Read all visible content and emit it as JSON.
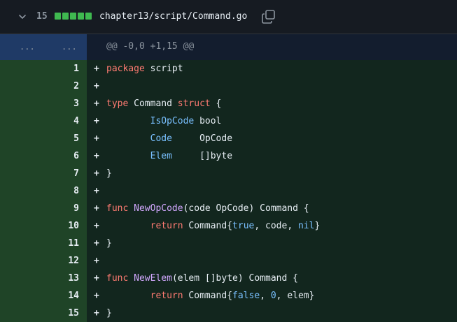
{
  "file": {
    "change_count": "15",
    "diffstat_blocks": 5,
    "path": "chapter13/script/Command.go",
    "accent_add": "#3fb950"
  },
  "hunk": {
    "old_dots": "...",
    "new_dots": "...",
    "header": "@@ -0,0 +1,15 @@"
  },
  "lines": [
    {
      "num": "1",
      "marker": "+",
      "tokens": [
        {
          "t": "package",
          "c": "kw"
        },
        {
          "t": " script",
          "c": ""
        }
      ]
    },
    {
      "num": "2",
      "marker": "+",
      "tokens": []
    },
    {
      "num": "3",
      "marker": "+",
      "tokens": [
        {
          "t": "type",
          "c": "kw"
        },
        {
          "t": " Command ",
          "c": ""
        },
        {
          "t": "struct",
          "c": "kw"
        },
        {
          "t": " {",
          "c": ""
        }
      ]
    },
    {
      "num": "4",
      "marker": "+",
      "tokens": [
        {
          "t": "        ",
          "c": ""
        },
        {
          "t": "IsOpCode",
          "c": "fld"
        },
        {
          "t": " bool",
          "c": ""
        }
      ]
    },
    {
      "num": "5",
      "marker": "+",
      "tokens": [
        {
          "t": "        ",
          "c": ""
        },
        {
          "t": "Code",
          "c": "fld"
        },
        {
          "t": "     OpCode",
          "c": ""
        }
      ]
    },
    {
      "num": "6",
      "marker": "+",
      "tokens": [
        {
          "t": "        ",
          "c": ""
        },
        {
          "t": "Elem",
          "c": "fld"
        },
        {
          "t": "     []byte",
          "c": ""
        }
      ]
    },
    {
      "num": "7",
      "marker": "+",
      "tokens": [
        {
          "t": "}",
          "c": ""
        }
      ]
    },
    {
      "num": "8",
      "marker": "+",
      "tokens": []
    },
    {
      "num": "9",
      "marker": "+",
      "tokens": [
        {
          "t": "func",
          "c": "kw"
        },
        {
          "t": " ",
          "c": ""
        },
        {
          "t": "NewOpCode",
          "c": "fn"
        },
        {
          "t": "(code OpCode) Command {",
          "c": ""
        }
      ]
    },
    {
      "num": "10",
      "marker": "+",
      "tokens": [
        {
          "t": "        ",
          "c": ""
        },
        {
          "t": "return",
          "c": "kw"
        },
        {
          "t": " Command{",
          "c": ""
        },
        {
          "t": "true",
          "c": "lit"
        },
        {
          "t": ", code, ",
          "c": ""
        },
        {
          "t": "nil",
          "c": "lit"
        },
        {
          "t": "}",
          "c": ""
        }
      ]
    },
    {
      "num": "11",
      "marker": "+",
      "tokens": [
        {
          "t": "}",
          "c": ""
        }
      ]
    },
    {
      "num": "12",
      "marker": "+",
      "tokens": []
    },
    {
      "num": "13",
      "marker": "+",
      "tokens": [
        {
          "t": "func",
          "c": "kw"
        },
        {
          "t": " ",
          "c": ""
        },
        {
          "t": "NewElem",
          "c": "fn"
        },
        {
          "t": "(elem []byte) Command {",
          "c": ""
        }
      ]
    },
    {
      "num": "14",
      "marker": "+",
      "tokens": [
        {
          "t": "        ",
          "c": ""
        },
        {
          "t": "return",
          "c": "kw"
        },
        {
          "t": " Command{",
          "c": ""
        },
        {
          "t": "false",
          "c": "lit"
        },
        {
          "t": ", ",
          "c": ""
        },
        {
          "t": "0",
          "c": "lit"
        },
        {
          "t": ", elem}",
          "c": ""
        }
      ]
    },
    {
      "num": "15",
      "marker": "+",
      "tokens": [
        {
          "t": "}",
          "c": ""
        }
      ]
    }
  ]
}
